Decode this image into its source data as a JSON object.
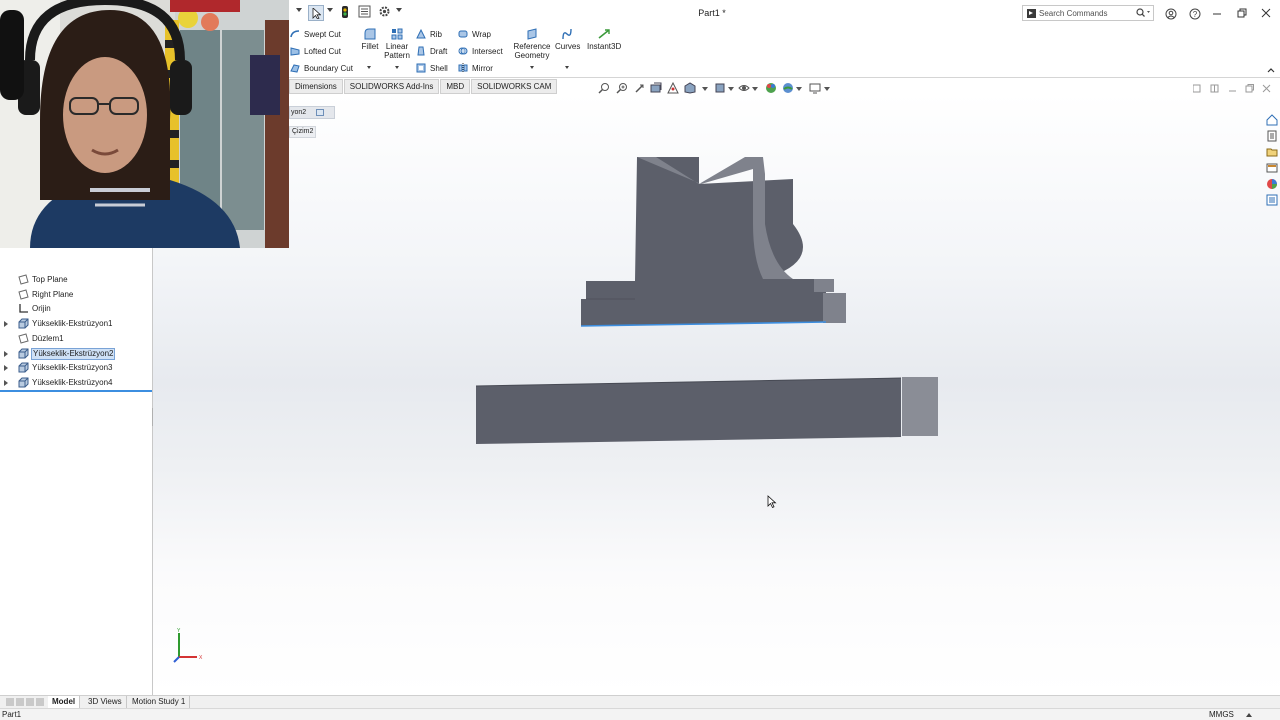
{
  "window": {
    "title": "Part1 *"
  },
  "search": {
    "placeholder": "Search Commands"
  },
  "ribbon": {
    "cut_items": [
      {
        "label": "Swept Cut",
        "icon": "swept-cut-icon"
      },
      {
        "label": "Lofted Cut",
        "icon": "lofted-cut-icon"
      },
      {
        "label": "Boundary Cut",
        "icon": "boundary-cut-icon"
      }
    ],
    "fillet": "Fillet",
    "linear_pattern": "Linear Pattern",
    "rib": "Rib",
    "draft": "Draft",
    "shell": "Shell",
    "wrap": "Wrap",
    "intersect": "Intersect",
    "mirror": "Mirror",
    "reference_geometry": "Reference Geometry",
    "curves": "Curves",
    "instant3d": "Instant3D"
  },
  "tabs": [
    "Dimensions",
    "SOLIDWORKS Add-Ins",
    "MBD",
    "SOLIDWORKS CAM"
  ],
  "flyout": {
    "feature": "yon2",
    "sketch": "Çizim2"
  },
  "feature_tree": [
    {
      "label": "Top Plane",
      "icon": "plane-icon",
      "expandable": false,
      "selected": false
    },
    {
      "label": "Right Plane",
      "icon": "plane-icon",
      "expandable": false,
      "selected": false
    },
    {
      "label": "Orijin",
      "icon": "origin-icon",
      "expandable": false,
      "selected": false
    },
    {
      "label": "Yükseklik-Ekstrüzyon1",
      "icon": "boss-extrude-icon",
      "expandable": true,
      "selected": false
    },
    {
      "label": "Düzlem1",
      "icon": "plane-icon",
      "expandable": false,
      "selected": false
    },
    {
      "label": "Yükseklik-Ekstrüzyon2",
      "icon": "boss-extrude-icon",
      "expandable": true,
      "selected": true
    },
    {
      "label": "Yükseklik-Ekstrüzyon3",
      "icon": "boss-extrude-icon",
      "expandable": true,
      "selected": false
    },
    {
      "label": "Yükseklik-Ekstrüzyon4",
      "icon": "boss-extrude-icon",
      "expandable": true,
      "selected": false
    }
  ],
  "bottom_tabs": [
    {
      "label": "Model",
      "active": true
    },
    {
      "label": "3D Views",
      "active": false
    },
    {
      "label": "Motion Study 1",
      "active": false
    }
  ],
  "status": {
    "document": "Part1",
    "units": "MMGS"
  },
  "colors": {
    "model_face": "#5c5f6a",
    "model_side": "#7f828c",
    "selection_blue": "#3c8ee0",
    "tree_highlight": "#cfe1f6"
  }
}
